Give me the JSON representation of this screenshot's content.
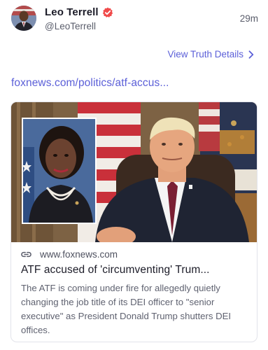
{
  "post": {
    "author_name": "Leo Terrell",
    "handle": "@LeoTerrell",
    "time": "29m",
    "view_details_label": "View Truth Details",
    "link_text": "foxnews.com/politics/atf-accus..."
  },
  "card": {
    "domain": "www.foxnews.com",
    "title": "ATF accused of 'circumventing' Trum...",
    "description": "The ATF is coming under fire for allegedly quietly changing the job title of its DEI officer to \"senior executive\" as President Donald Trump shutters DEI offices."
  },
  "colors": {
    "accent": "#5b5fd8",
    "verified_badge": "#f04b4b",
    "text_primary": "#1c1c28",
    "text_secondary": "#5a5d6b"
  },
  "icons": {
    "verified": "verified-badge-icon",
    "chevron": "chevron-right-icon",
    "link": "link-icon"
  }
}
